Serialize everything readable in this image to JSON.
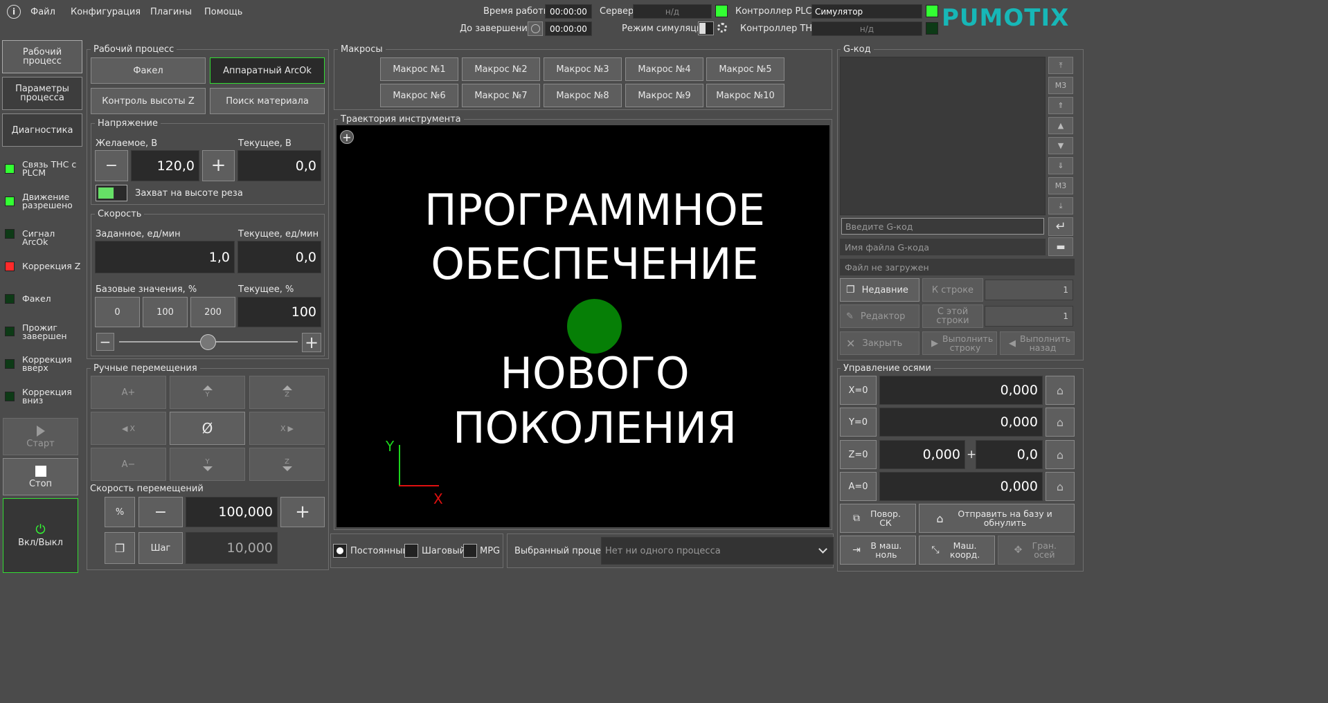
{
  "menu": {
    "items": [
      "Файл",
      "Конфигурация",
      "Плагины",
      "Помощь"
    ]
  },
  "status": {
    "work_time_label": "Время работы",
    "work_time": "00:00:00",
    "remain_label": "До завершения",
    "remain_time": "00:00:00",
    "server_label": "Сервер",
    "server_value": "н/д",
    "sim_label": "Режим симуляции",
    "plcm_label": "Контроллер PLCM",
    "plcm_value": "Симулятор",
    "thc_label": "Контроллер THC",
    "thc_value": "н/д"
  },
  "logo": "PUMOTIX",
  "sidebar": {
    "tabs": [
      "Рабочий процесс",
      "Параметры процесса",
      "Диагностика"
    ],
    "indicators": [
      {
        "label": "Связь THC с PLCM",
        "color": "#33ff33"
      },
      {
        "label": "Движение разрешено",
        "color": "#33ff33"
      },
      {
        "label": "Сигнал ArcOk",
        "color": "#0d3a16"
      },
      {
        "label": "Коррекция Z",
        "color": "#ff2a2a"
      },
      {
        "label": "Факел",
        "color": "#0d3a16"
      },
      {
        "label": "Прожиг завершен",
        "color": "#0d3a16"
      },
      {
        "label": "Коррекция вверх",
        "color": "#0d3a16"
      },
      {
        "label": "Коррекция вниз",
        "color": "#0d3a16"
      }
    ],
    "start": "Старт",
    "stop": "Стоп",
    "power": "Вкл/Выкл"
  },
  "process": {
    "title": "Рабочий процесс",
    "torch": "Факел",
    "arcok": "Аппаратный ArcOk",
    "zcontrol": "Контроль высоты Z",
    "search": "Поиск материала"
  },
  "voltage": {
    "title": "Напряжение",
    "desired_label": "Желаемое, В",
    "desired": "120,0",
    "current_label": "Текущее, В",
    "current": "0,0",
    "capture_label": "Захват на высоте реза"
  },
  "speed": {
    "title": "Скорость",
    "set_label": "Заданное, ед/мин",
    "set": "1,0",
    "current_label": "Текущее, ед/мин",
    "current": "0,0",
    "base_label": "Базовые значения, %",
    "base": [
      "0",
      "100",
      "200"
    ],
    "cur_pct_label": "Текущее, %",
    "cur_pct": "100",
    "slider_fraction": 0.5
  },
  "jog": {
    "title": "Ручные перемещения",
    "buttons": [
      "A+",
      "Y",
      "Z",
      "X",
      "Ø",
      "X",
      "A−",
      "Y",
      "Z"
    ],
    "speed_title": "Скорость перемещений",
    "pct": "%",
    "speed": "100,000",
    "step_label": "Шаг",
    "step": "10,000"
  },
  "macros": {
    "title": "Макросы",
    "items": [
      "Макрос №1",
      "Макрос №2",
      "Макрос №3",
      "Макрос №4",
      "Макрос №5",
      "Макрос №6",
      "Макрос №7",
      "Макрос №8",
      "Макрос №9",
      "Макрос №10"
    ]
  },
  "toolpath": {
    "title": "Траектория инструмента",
    "line1": "ПРОГРАММНОЕ",
    "line2": "ОБЕСПЕЧЕНИЕ",
    "line3": "НОВОГО",
    "line4": "ПОКОЛЕНИЯ",
    "axis_y": "Y",
    "axis_x": "X"
  },
  "modes": {
    "continuous": "Постоянный",
    "step": "Шаговый",
    "mpg": "MPG"
  },
  "selected": {
    "label": "Выбранный процесс",
    "placeholder": "Нет ни одного процесса"
  },
  "gcode": {
    "title": "G-код",
    "input_placeholder": "Введите G-код",
    "file_placeholder": "Имя файла G-кода",
    "file_status": "Файл не загружен",
    "recent": "Недавние",
    "to_line": "К строке",
    "to_line_val": "1",
    "editor": "Редактор",
    "from_line": "С этой строки",
    "from_line_val": "1",
    "close": "Закрыть",
    "run_line": "Выполнить строку",
    "run_back": "Выполнить назад"
  },
  "axes": {
    "title": "Управление осями",
    "x_btn": "X=0",
    "x": "0,000",
    "y_btn": "Y=0",
    "y": "0,000",
    "z_btn": "Z=0",
    "z": "0,000",
    "z_plus": "+",
    "z_off": "0,0",
    "a_btn": "A=0",
    "a": "0,000",
    "rot": "Повор. СК",
    "send_home": "Отправить на базу и обнулить",
    "to_zero": "В маш. ноль",
    "mach": "Маш. коорд.",
    "limits": "Гран. осей"
  }
}
